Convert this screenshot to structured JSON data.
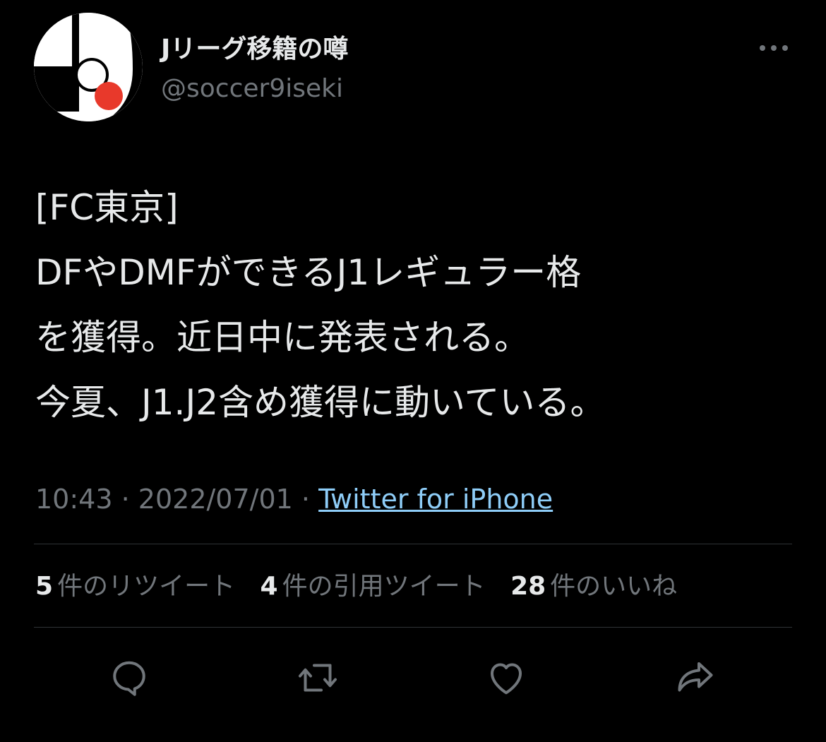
{
  "author": {
    "display_name": "Jリーグ移籍の噂",
    "handle": "@soccer9iseki"
  },
  "tweet": {
    "lines": [
      "[FC東京]",
      "DFやDMFができるJ1レギュラー格",
      "を獲得。近日中に発表される。",
      "今夏、J1.J2含め獲得に動いている。"
    ],
    "time": "10:43",
    "date": "2022/07/01",
    "separator": "·",
    "source": "Twitter for iPhone"
  },
  "stats": {
    "retweets": {
      "count": "5",
      "label": "件のリツイート"
    },
    "quotes": {
      "count": "4",
      "label": "件の引用ツイート"
    },
    "likes": {
      "count": "28",
      "label": "件のいいね"
    }
  },
  "icons": {
    "more": "more-horizontal-icon",
    "reply": "reply-icon",
    "retweet": "retweet-icon",
    "like": "heart-icon",
    "share": "share-icon"
  },
  "colors": {
    "background": "#000000",
    "text": "#e7e9ea",
    "muted": "#71767b",
    "link": "#8ecdf8",
    "divider": "#2f3336",
    "avatar_accent": "#e8392b"
  }
}
